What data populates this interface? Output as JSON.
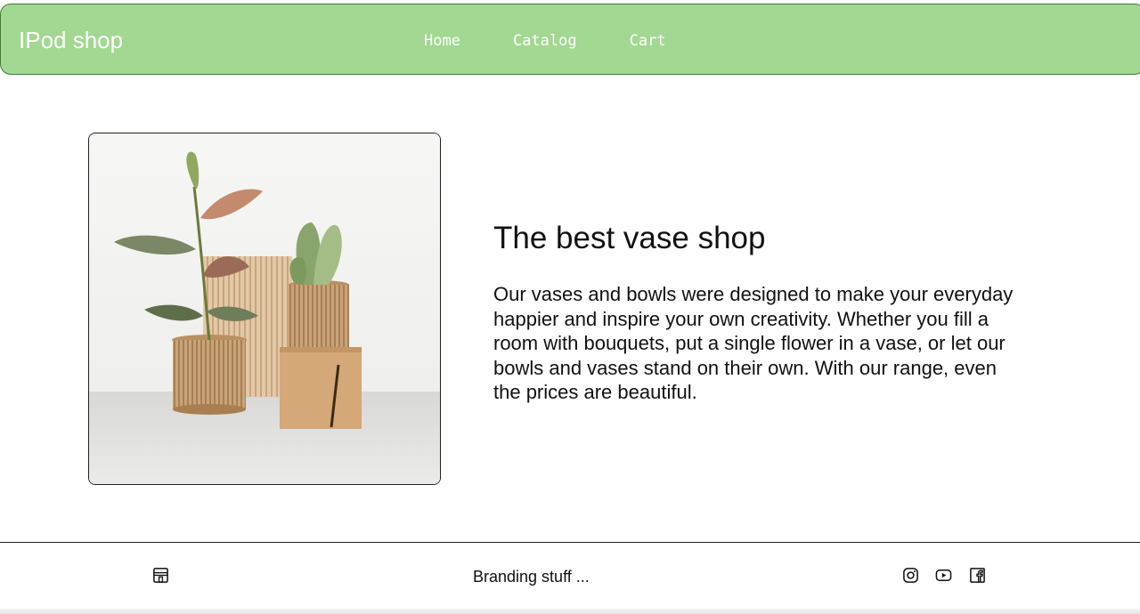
{
  "header": {
    "brand": "IPod shop",
    "nav": [
      {
        "label": "Home"
      },
      {
        "label": "Catalog"
      },
      {
        "label": "Cart"
      }
    ],
    "bg_color": "#a2d891"
  },
  "hero": {
    "title": "The best vase shop",
    "text": "Our vases and bowls were designed to make your everyday happier and inspire your own creativity. Whether you fill a room with bouquets, put a single flower in a vase, or let our bowls and vases stand on their own. With our range, even the prices are beautiful."
  },
  "footer": {
    "branding": "Branding stuff ...",
    "icons": [
      "store-icon",
      "instagram-icon",
      "youtube-icon",
      "facebook-icon"
    ]
  }
}
